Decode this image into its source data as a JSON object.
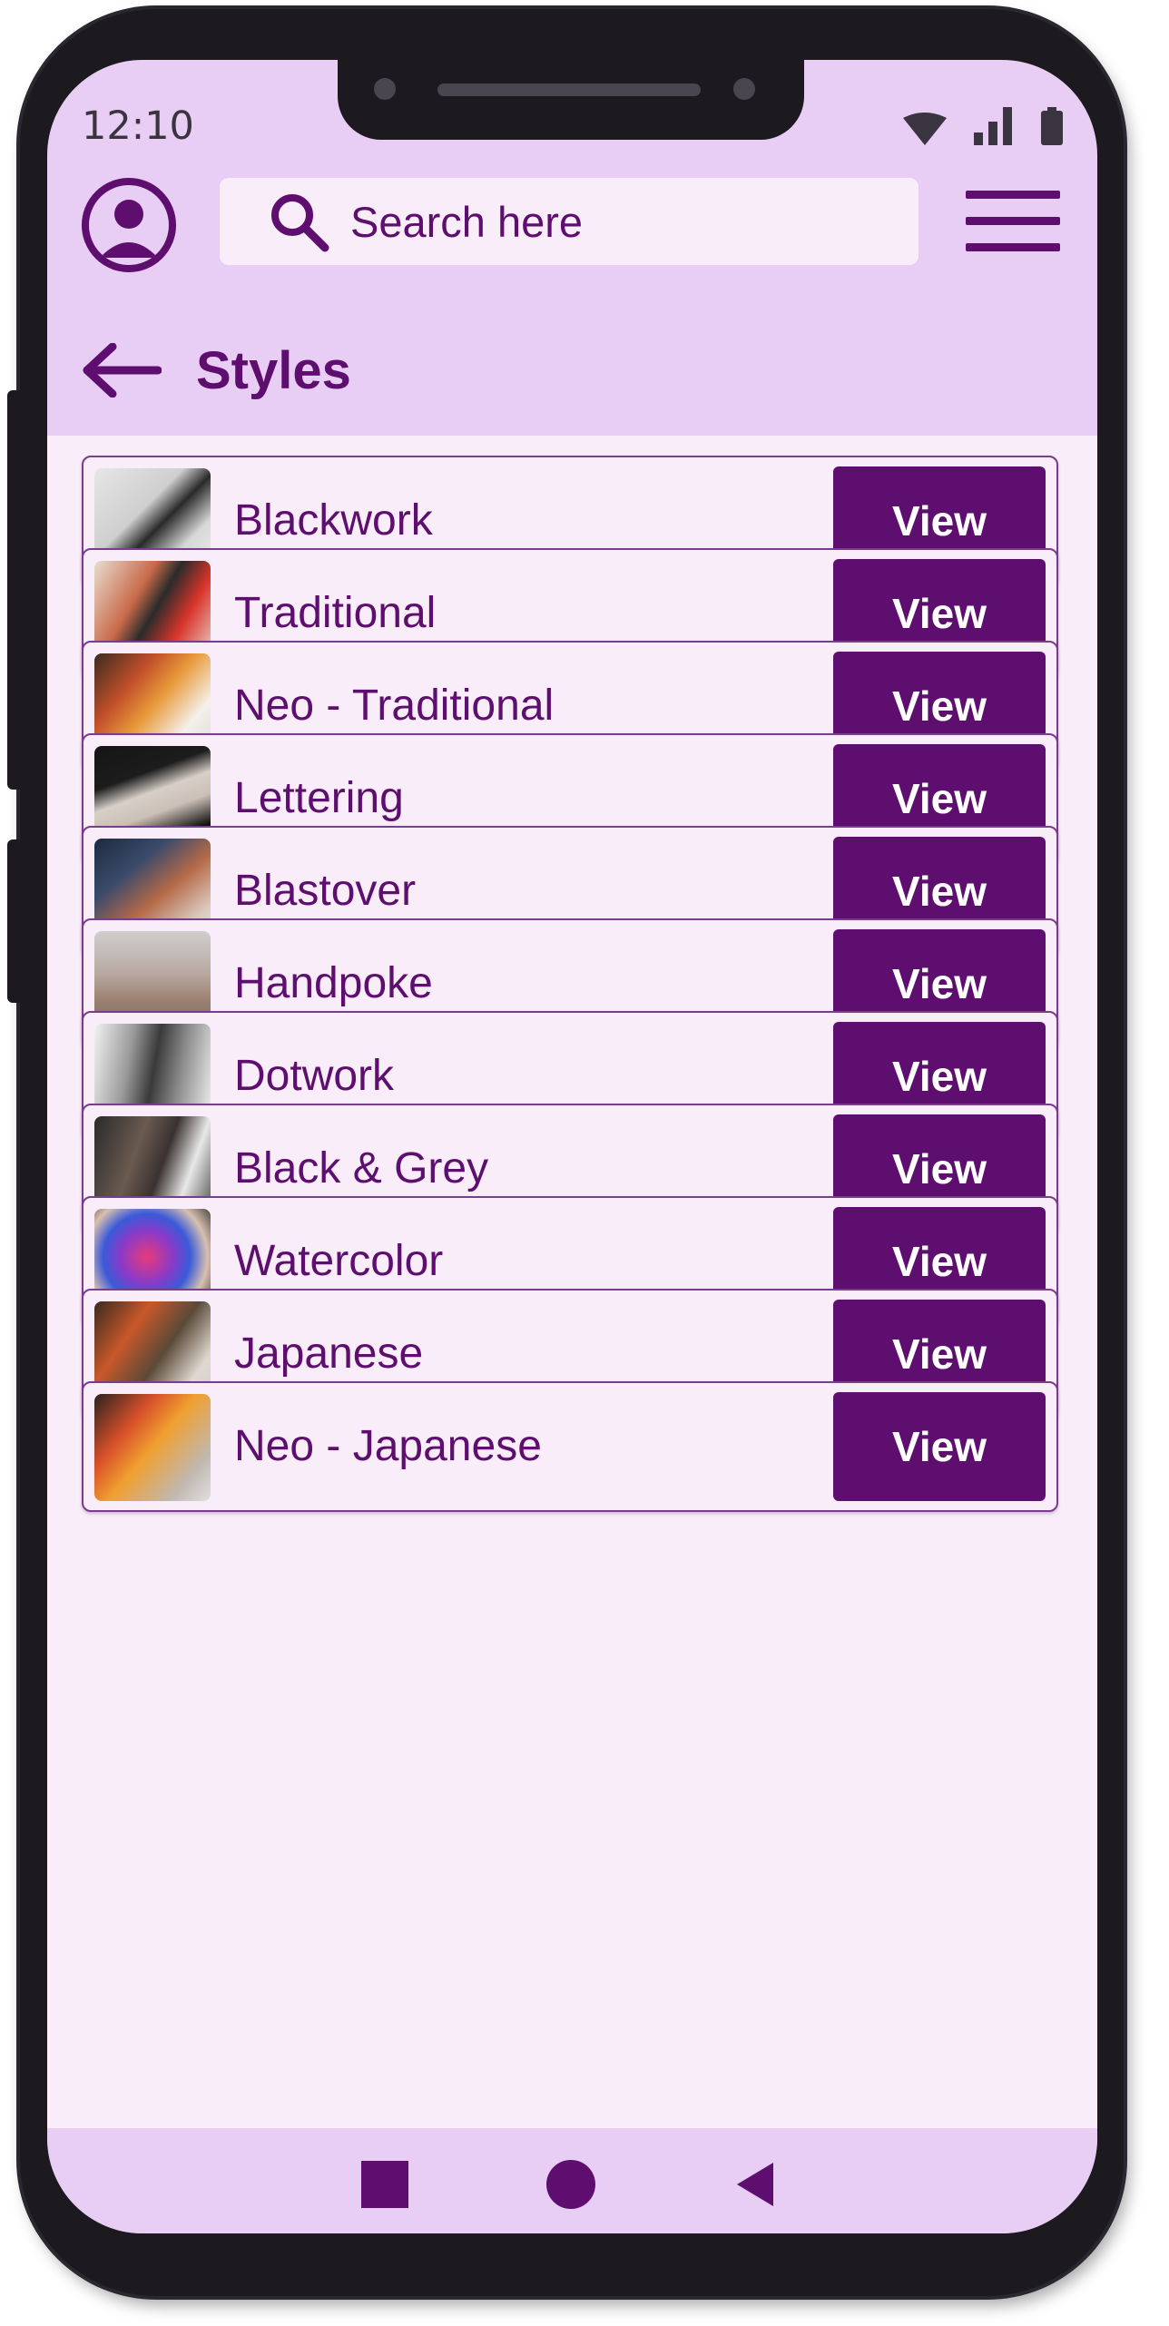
{
  "status_bar": {
    "time": "12:10"
  },
  "header": {
    "search_placeholder": "Search here"
  },
  "page": {
    "title": "Styles"
  },
  "styles": [
    {
      "label": "Blackwork",
      "button": "View"
    },
    {
      "label": "Traditional",
      "button": "View"
    },
    {
      "label": "Neo - Traditional",
      "button": "View"
    },
    {
      "label": "Lettering",
      "button": "View"
    },
    {
      "label": "Blastover",
      "button": "View"
    },
    {
      "label": "Handpoke",
      "button": "View"
    },
    {
      "label": "Dotwork",
      "button": "View"
    },
    {
      "label": "Black & Grey",
      "button": "View"
    },
    {
      "label": "Watercolor",
      "button": "View"
    },
    {
      "label": "Japanese",
      "button": "View"
    },
    {
      "label": "Neo - Japanese",
      "button": "View"
    }
  ],
  "colors": {
    "accent": "#5e0e6f",
    "background": "#e8cdf4",
    "surface": "#f9edf9"
  },
  "icons": {
    "profile": "user-circle-icon",
    "search": "search-icon",
    "menu": "hamburger-menu-icon",
    "back": "arrow-left-icon"
  }
}
